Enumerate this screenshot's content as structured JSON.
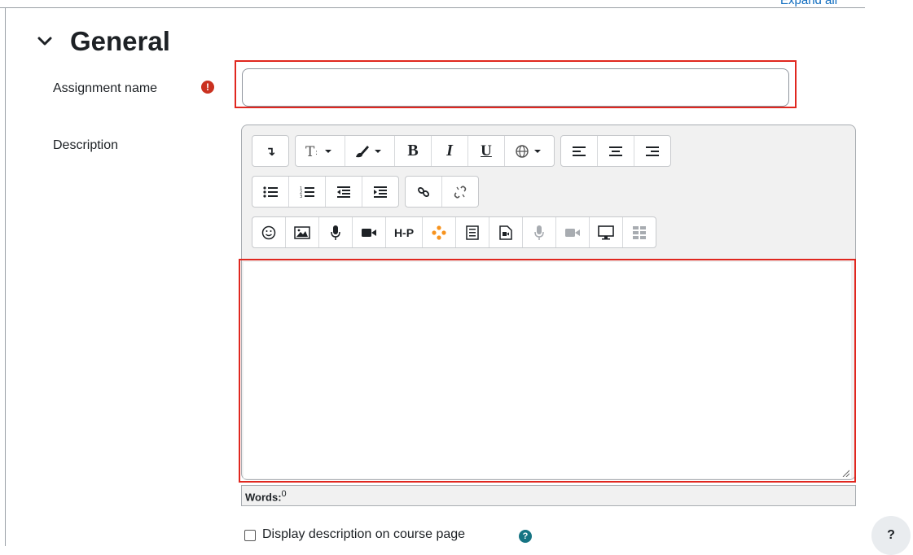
{
  "header": {
    "expand_all_label": "Expand all"
  },
  "section": {
    "title": "General"
  },
  "assignment": {
    "name_label": "Assignment name",
    "name_value": ""
  },
  "description": {
    "label": "Description",
    "toolbar": {
      "toggle_icon": "↴",
      "bold": "B",
      "italic": "I",
      "underline": "U",
      "h5p": "H-P"
    },
    "words_label": "Words:",
    "words_count": "0"
  },
  "options": {
    "display_description_label": "Display description on course page"
  },
  "help_button_label": "?",
  "colors": {
    "highlight": "#e0271f",
    "required": "#ca3120",
    "info": "#167483",
    "link": "#0f6cbf"
  }
}
